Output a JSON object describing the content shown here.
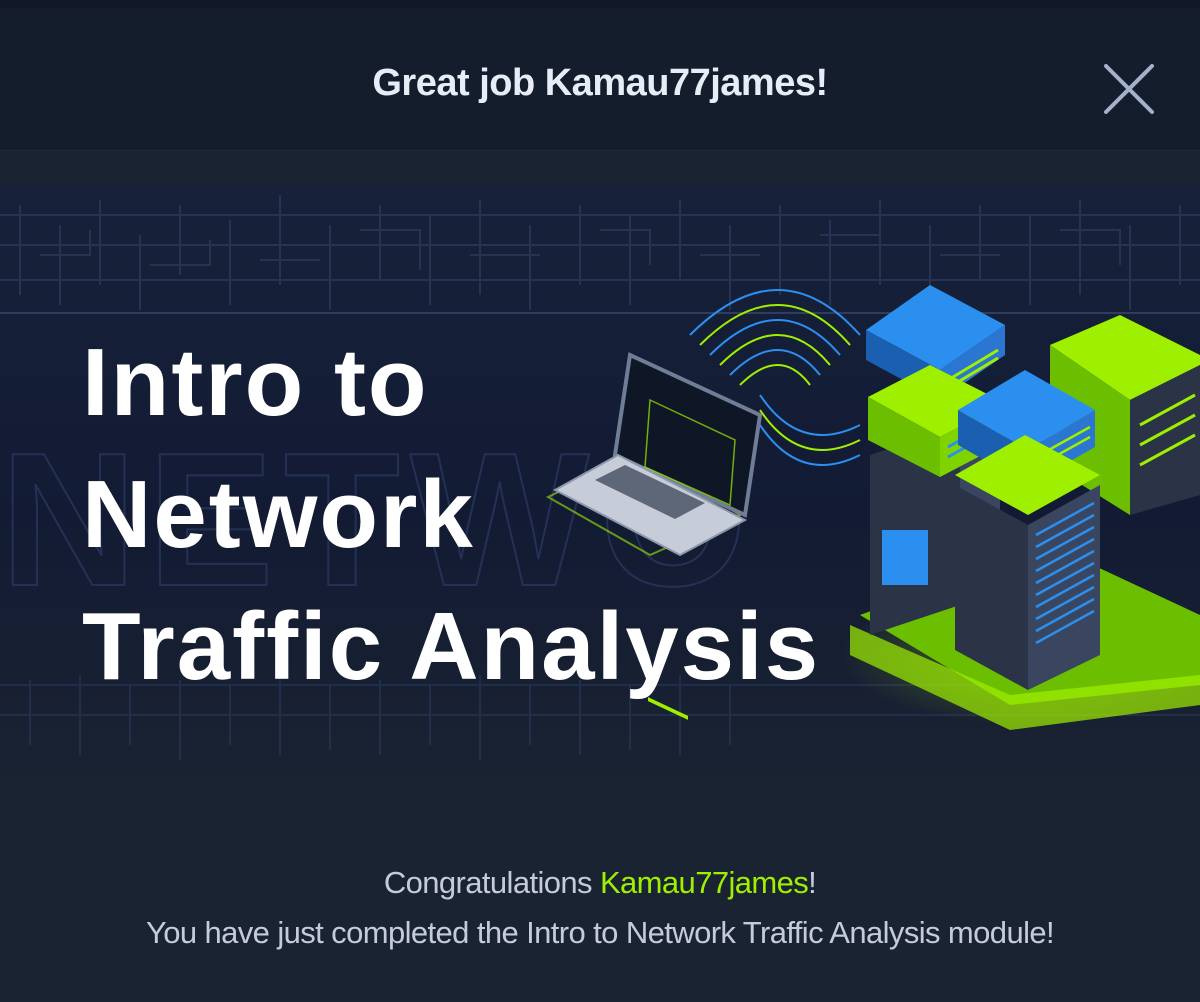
{
  "header": {
    "title": "Great job Kamau77james!"
  },
  "banner": {
    "title_lines": [
      "Intro to",
      "Network",
      "Traffic Analysis"
    ],
    "watermark": "NETWO"
  },
  "message": {
    "greeting": "Congratulations ",
    "username": "Kamau77james",
    "greeting_end": "!",
    "completion": "You have just completed the Intro to Network Traffic Analysis module!"
  },
  "icons": {
    "close": "close-icon",
    "laptop": "laptop-illustration",
    "servers": "server-stack-illustration"
  },
  "colors": {
    "accent": "#9fef00",
    "server_blue": "#2b8ff0",
    "background": "#1a2332"
  }
}
